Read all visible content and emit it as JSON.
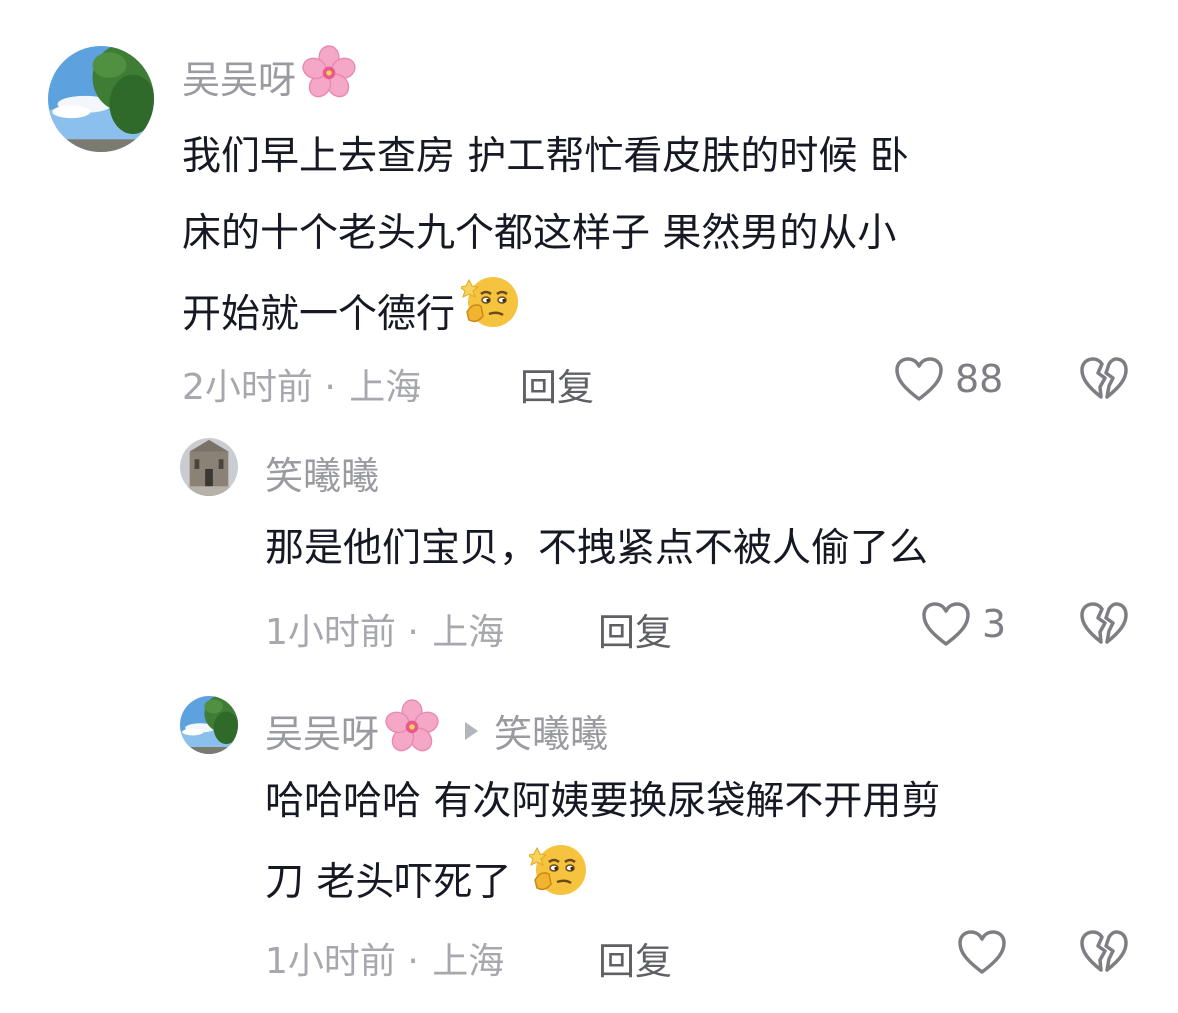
{
  "comments": [
    {
      "username": "吴吴呀",
      "content_lines": [
        "我们早上去查房 护工帮忙看皮肤的时候 卧",
        "床的十个老头九个都这样子 果然男的从小",
        "开始就一个德行"
      ],
      "time": "2小时前",
      "location": "上海",
      "reply_label": "回复",
      "likes": "88"
    },
    {
      "username": "笑曦曦",
      "content_lines": [
        "那是他们宝贝，不拽紧点不被人偷了么"
      ],
      "time": "1小时前",
      "location": "上海",
      "reply_label": "回复",
      "likes": "3"
    },
    {
      "username": "吴吴呀",
      "reply_to": "笑曦曦",
      "content_lines": [
        "哈哈哈哈 有次阿姨要换尿袋解不开用剪",
        "刀 老头吓死了"
      ],
      "time": "1小时前",
      "location": "上海",
      "reply_label": "回复",
      "likes": ""
    }
  ],
  "separator": " · ",
  "icons": {
    "like": "heart-outline-icon",
    "dislike": "broken-heart-icon",
    "username_badge": "cherry-blossom-emoji",
    "content_emoji": "thinking-face-emoji"
  },
  "colors": {
    "username": "#9a9ba1",
    "text": "#161823",
    "meta": "#a7a8ad",
    "reply": "#5f6066"
  }
}
